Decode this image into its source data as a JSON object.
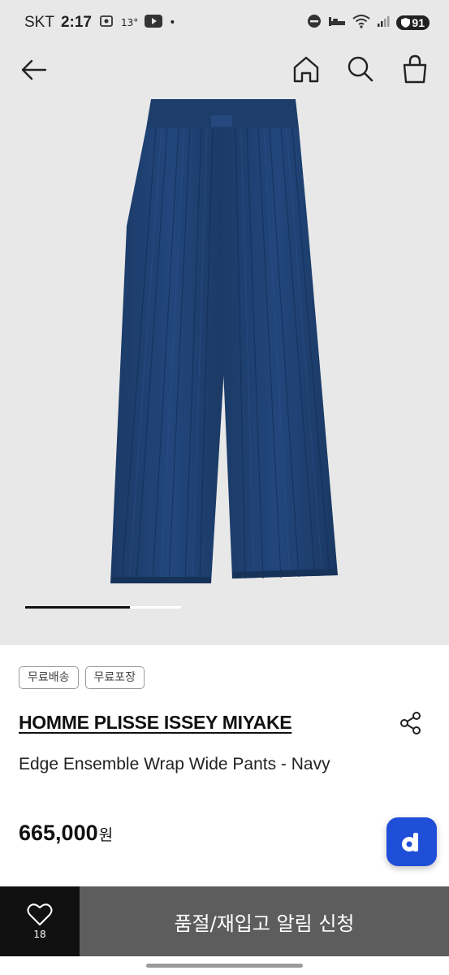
{
  "status_bar": {
    "carrier": "SKT",
    "time": "2:17",
    "temperature": "13°",
    "dot": "•",
    "battery": "91"
  },
  "nav": {
    "back_icon": "arrow-left-icon",
    "home_icon": "home-icon",
    "search_icon": "search-icon",
    "bag_icon": "shopping-bag-icon"
  },
  "gallery": {
    "progress": 0.67
  },
  "tags": [
    "무료배송",
    "무료포장"
  ],
  "product": {
    "brand": "HOMME PLISSE ISSEY MIYAKE",
    "name": "Edge Ensemble Wrap Wide Pants - Navy",
    "price": "665,000",
    "currency": "원"
  },
  "actions": {
    "like_count": "18",
    "restock_label": "품절/재입고 알림 신청"
  },
  "colors": {
    "accent": "#1f4ed8",
    "garment": "#1e3f6e",
    "cta": "#5d5d5d"
  }
}
